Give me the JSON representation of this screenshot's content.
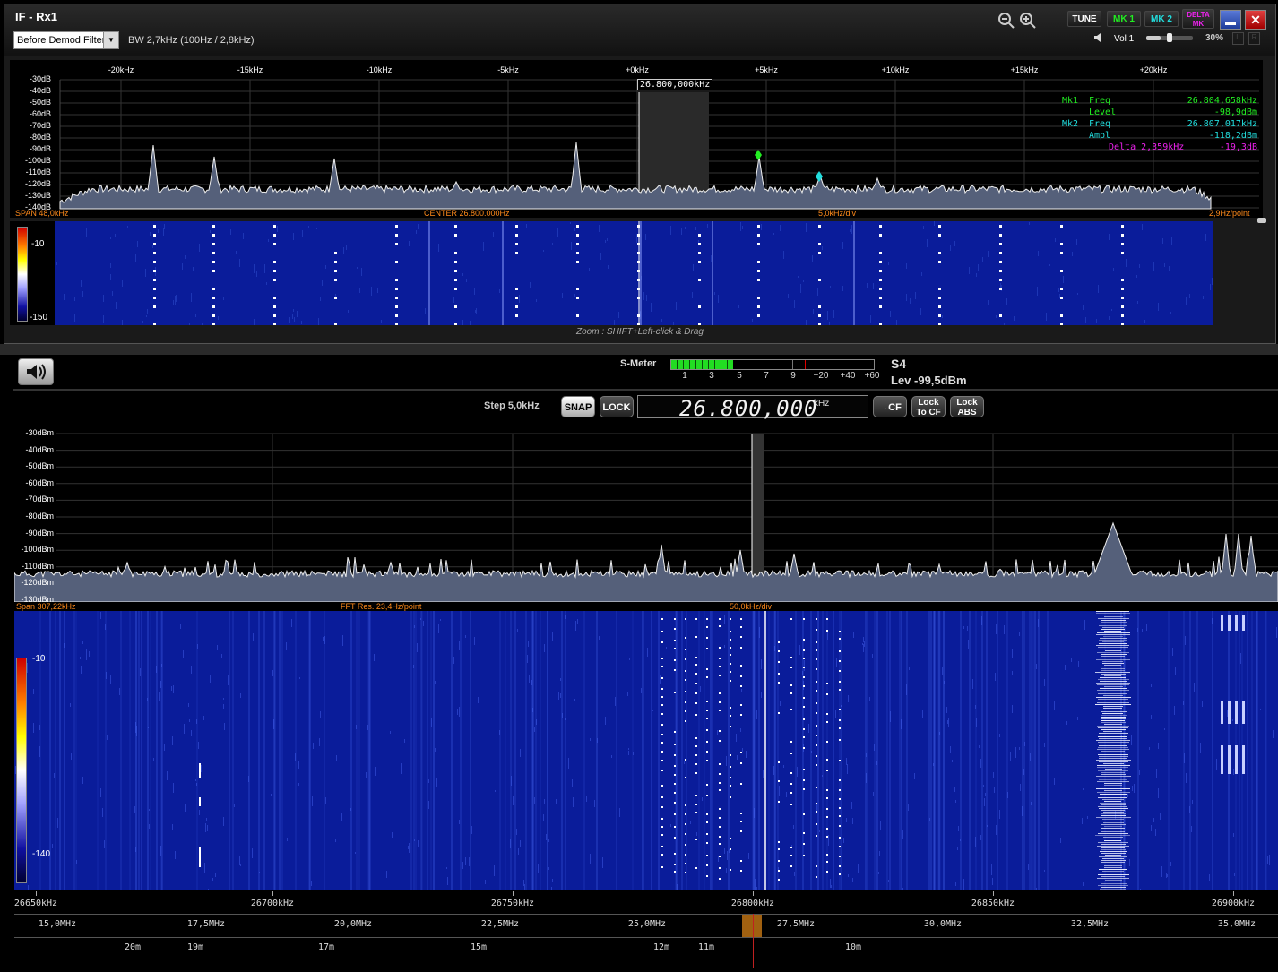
{
  "top": {
    "title": "IF - Rx1",
    "filter_select": "Before Demod Filter",
    "bw": "BW  2,7kHz (100Hz / 2,8kHz)",
    "buttons": {
      "tune": "TUNE",
      "mk1": "MK 1",
      "mk2": "MK 2",
      "delta": "DELTA MK"
    },
    "vol_label": "Vol 1",
    "vol_pct": "30%",
    "vol_level": 0.3,
    "freq_ticks": [
      "-20kHz",
      "-15kHz",
      "-10kHz",
      "-5kHz",
      "+0kHz",
      "+5kHz",
      "+10kHz",
      "+15kHz",
      "+20kHz"
    ],
    "db_ticks": [
      "-30dB",
      "-40dB",
      "-50dB",
      "-60dB",
      "-70dB",
      "-80dB",
      "-90dB",
      "-100dB",
      "-110dB",
      "-120dB",
      "-130dB",
      "-140dB"
    ],
    "center_tag": "26.800,000kHz",
    "markers": [
      {
        "label": "Mk1",
        "field": "Freq",
        "value": "26.804,658kHz",
        "color": "#22ee22"
      },
      {
        "label": "",
        "field": "Level",
        "value": "-98,9dBm",
        "color": "#22ee22"
      },
      {
        "label": "Mk2",
        "field": "Freq",
        "value": "26.807,017kHz",
        "color": "#22dddd"
      },
      {
        "label": "",
        "field": "Ampl",
        "value": "-118,2dBm",
        "color": "#22dddd"
      },
      {
        "label": "",
        "field": "Delta 2,359kHz",
        "value": "-19,3dB",
        "color": "#ee22ee"
      }
    ],
    "span": "SPAN 48,0kHz",
    "center": "CENTER 26.800.000Hz",
    "div": "5,0kHz/div",
    "res": "2,9Hz/point",
    "wf_max": "-10",
    "wf_min": "-150",
    "zoom_hint": "Zoom : SHIFT+Left-click & Drag"
  },
  "bottom": {
    "smeter_label": "S-Meter",
    "smeter_level": 0.46,
    "smeter_scale": [
      "1",
      "3",
      "5",
      "7",
      "9",
      "+20",
      "+40",
      "+60"
    ],
    "s_value": "S4",
    "lev": "Lev -99,5dBm",
    "step": "Step 5,0kHz",
    "snap": "SNAP",
    "lock": "LOCK",
    "freq": "26.800,000",
    "freq_unit": "kHz",
    "cf": "→CF",
    "lock_cf": [
      "Lock",
      "To CF"
    ],
    "lock_abs": [
      "Lock",
      "ABS"
    ],
    "dbm_ticks": [
      "-30dBm",
      "-40dBm",
      "-50dBm",
      "-60dBm",
      "-70dBm",
      "-80dBm",
      "-90dBm",
      "-100dBm",
      "-110dBm",
      "-120dBm",
      "-130dBm"
    ],
    "span": "Span 307,22kHz",
    "fft": "FFT Res. 23,4Hz/point",
    "div": "50,0kHz/div",
    "wf_max": "-10",
    "wf_min": "-140",
    "freq_ticks": [
      "26650kHz",
      "26700kHz",
      "26750kHz",
      "26800kHz",
      "26850kHz",
      "26900kHz"
    ],
    "band_ticks": [
      "15,0MHz",
      "17,5MHz",
      "20,0MHz",
      "22,5MHz",
      "25,0MHz",
      "27,5MHz",
      "30,0MHz",
      "32,5MHz",
      "35,0MHz"
    ],
    "meter_bands": [
      "20m",
      "19m",
      "17m",
      "15m",
      "12m",
      "11m",
      "10m"
    ]
  }
}
